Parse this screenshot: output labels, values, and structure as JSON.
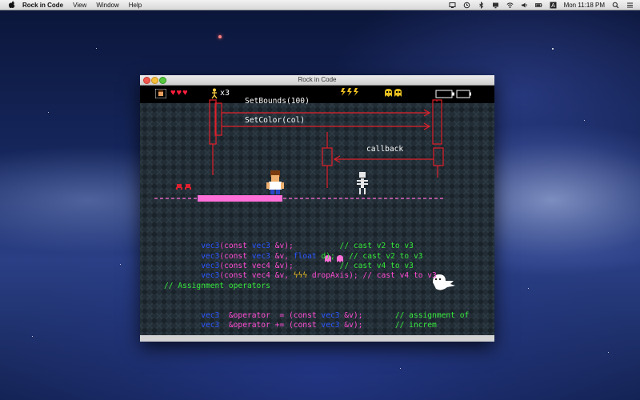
{
  "menubar": {
    "app_name": "Rock in Code",
    "items": [
      "View",
      "Window",
      "Help"
    ],
    "clock": "Mon 11:18 PM"
  },
  "window": {
    "title": "Rock in Code"
  },
  "hud": {
    "lives_label": "x3",
    "hearts": "♥♥♥"
  },
  "diagram": {
    "set_bounds": "SetBounds(100)",
    "set_color": "SetColor(col)",
    "callback": "callback"
  },
  "code_lines": [
    {
      "a": "vec3",
      "b": "(",
      "c": "const",
      "d": "vec3",
      "e": " &v);",
      "f": "",
      "g": "          // cast v2 to v3"
    },
    {
      "a": "vec3",
      "b": "(",
      "c": "const",
      "d": "vec3",
      "e": " &v,",
      "f": "float",
      "g": " d);   // cast v2 to v3"
    },
    {
      "a": "vec3",
      "b": "(",
      "c": "const",
      "d": "vec4",
      "e": " &v);",
      "f": "",
      "g": "          // cast v4 to v3"
    },
    {
      "a": "vec3",
      "b": "(",
      "c": "const",
      "d": "vec4",
      "e": " &v,",
      "f": "",
      "g": " dropAxis); // cast v4 to v3"
    }
  ],
  "comment_line": "// Assignment operators",
  "assign_lines": [
    {
      "a": "vec3",
      "b": "  &operator  = (",
      "c": "const",
      "d": "vec3",
      "e": " &v);",
      "g": "       // assignment of"
    },
    {
      "a": "vec3",
      "b": "  &operator += (",
      "c": "const",
      "d": "vec3",
      "e": " &v);",
      "g": "       // increm"
    }
  ],
  "colors": {
    "code_keyword": "#2a55ff",
    "code_text": "#ff4bd2",
    "code_comment": "#35e83a",
    "heart": "#ff1e3c",
    "diagram_line": "#e0202a",
    "platform": "#ff6fd8"
  }
}
